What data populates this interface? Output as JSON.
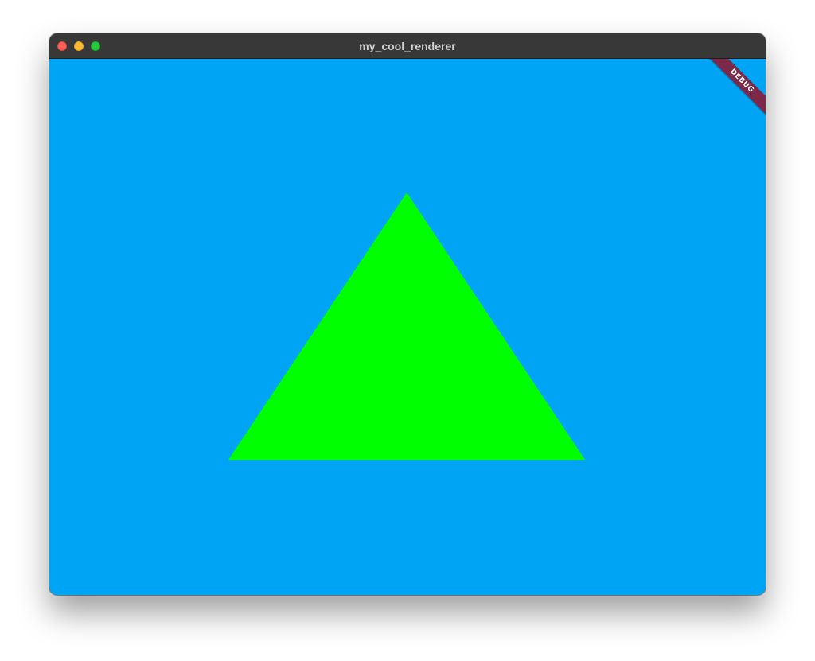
{
  "window": {
    "title": "my_cool_renderer"
  },
  "canvas": {
    "background_color": "#00a4f5",
    "shape": "triangle",
    "shape_color": "#00ff00"
  },
  "debug_banner": {
    "label": "DEBUG",
    "color": "#7a2a48"
  },
  "traffic_lights": {
    "close_icon": "close-icon",
    "minimize_icon": "minimize-icon",
    "maximize_icon": "maximize-icon"
  }
}
